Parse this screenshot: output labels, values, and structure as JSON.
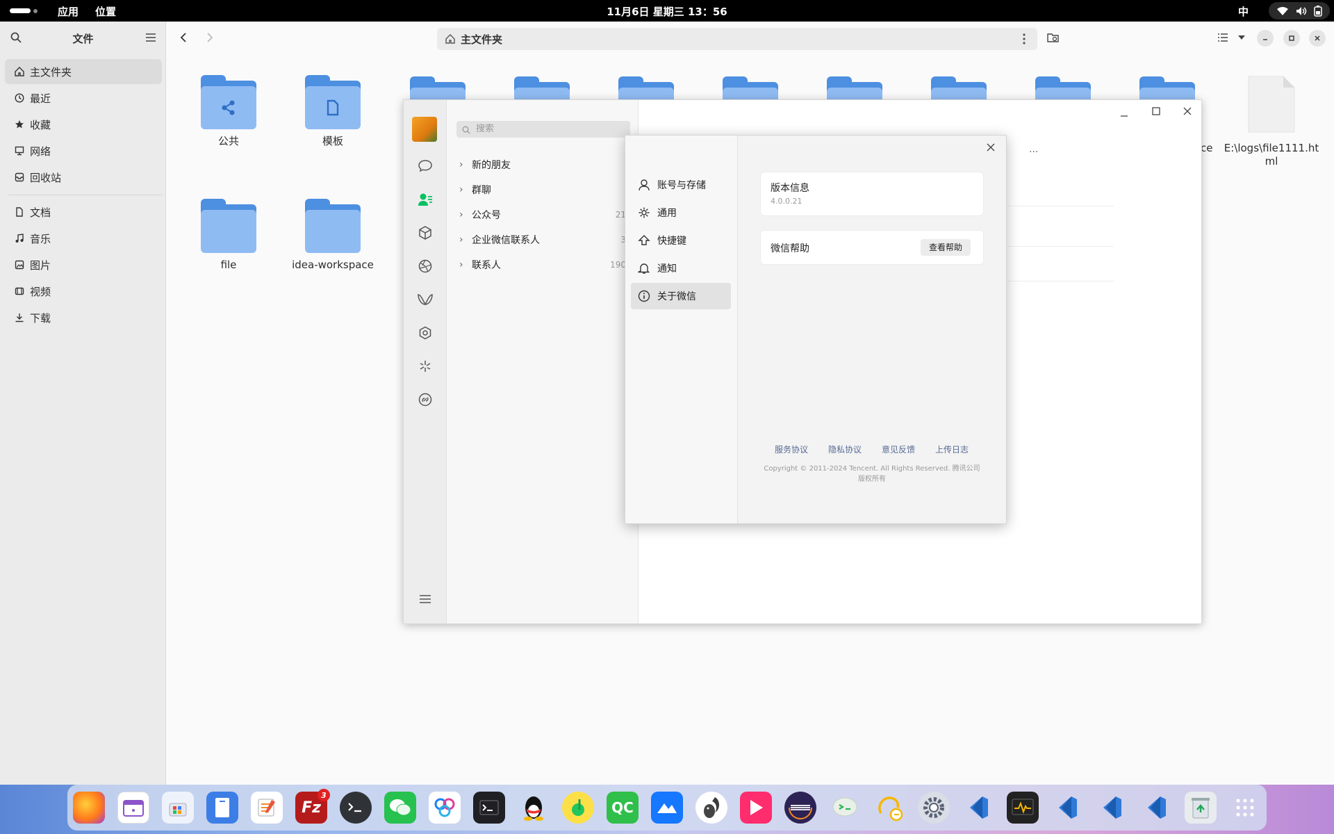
{
  "topbar": {
    "apps_label": "应用",
    "places_label": "位置",
    "clock": "11月6日 星期三  13：56",
    "input_method": "中"
  },
  "files": {
    "sidebar_title": "文件",
    "path": "主文件夹",
    "sidebar_items": [
      {
        "label": "主文件夹",
        "icon": "home-icon"
      },
      {
        "label": "最近",
        "icon": "clock-icon"
      },
      {
        "label": "收藏",
        "icon": "star-icon"
      },
      {
        "label": "网络",
        "icon": "network-icon"
      },
      {
        "label": "回收站",
        "icon": "trash-icon"
      },
      {
        "label": "文档",
        "icon": "document-icon"
      },
      {
        "label": "音乐",
        "icon": "music-icon"
      },
      {
        "label": "图片",
        "icon": "picture-icon"
      },
      {
        "label": "视频",
        "icon": "video-icon"
      },
      {
        "label": "下载",
        "icon": "download-icon"
      }
    ],
    "folders": [
      {
        "label": "公共"
      },
      {
        "label": "模板"
      },
      {
        "label": "file"
      },
      {
        "label": "idea-workspace"
      }
    ],
    "partial_label": "ce",
    "file_label": "E:\\logs\\file1111.html"
  },
  "wechat": {
    "search_placeholder": "搜索",
    "contacts": [
      {
        "label": "新的朋友",
        "count": ""
      },
      {
        "label": "群聊",
        "count": ""
      },
      {
        "label": "公众号",
        "count": "21"
      },
      {
        "label": "企业微信联系人",
        "count": "3"
      },
      {
        "label": "联系人",
        "count": "190"
      }
    ],
    "more_label": "···"
  },
  "settings": {
    "menu": [
      {
        "label": "账号与存储",
        "icon": "user-icon"
      },
      {
        "label": "通用",
        "icon": "gear-icon"
      },
      {
        "label": "快捷键",
        "icon": "shortcut-icon"
      },
      {
        "label": "通知",
        "icon": "bell-icon"
      },
      {
        "label": "关于微信",
        "icon": "info-icon"
      }
    ],
    "version_title": "版本信息",
    "version_value": "4.0.0.21",
    "help_title": "微信帮助",
    "help_button": "查看帮助",
    "links": [
      "服务协议",
      "隐私协议",
      "意见反馈",
      "上传日志"
    ],
    "copyright_line1": "Copyright © 2011-2024 Tencent. All Rights Reserved. 腾讯公司",
    "copyright_line2": "版权所有"
  },
  "dock": {
    "filezilla_badge": "3",
    "qc_label": "QC"
  },
  "colors": {
    "folder": "#4d8fe0",
    "folder_light": "#8fbbf3",
    "wechat_green": "#07c160",
    "link": "#576b95"
  }
}
